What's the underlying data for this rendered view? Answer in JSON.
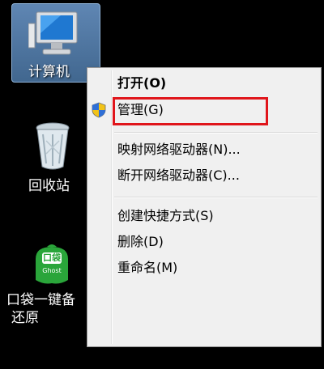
{
  "desktop": {
    "icons": [
      {
        "label": "计算机"
      },
      {
        "label": "回收站"
      },
      {
        "label": "口袋一键备",
        "label2": "还原",
        "badge_text": "口袋",
        "badge_sub": "Ghost"
      }
    ]
  },
  "context_menu": {
    "items": [
      {
        "label": "打开(O)"
      },
      {
        "label": "管理(G)"
      },
      {
        "label": "映射网络驱动器(N)..."
      },
      {
        "label": "断开网络驱动器(C)..."
      },
      {
        "label": "创建快捷方式(S)"
      },
      {
        "label": "删除(D)"
      },
      {
        "label": "重命名(M)"
      }
    ]
  },
  "colors": {
    "highlight": "#e0151b",
    "selection": "#4f77a3",
    "menu_bg": "#f0f0f0",
    "ghost_green": "#2aa53a"
  }
}
